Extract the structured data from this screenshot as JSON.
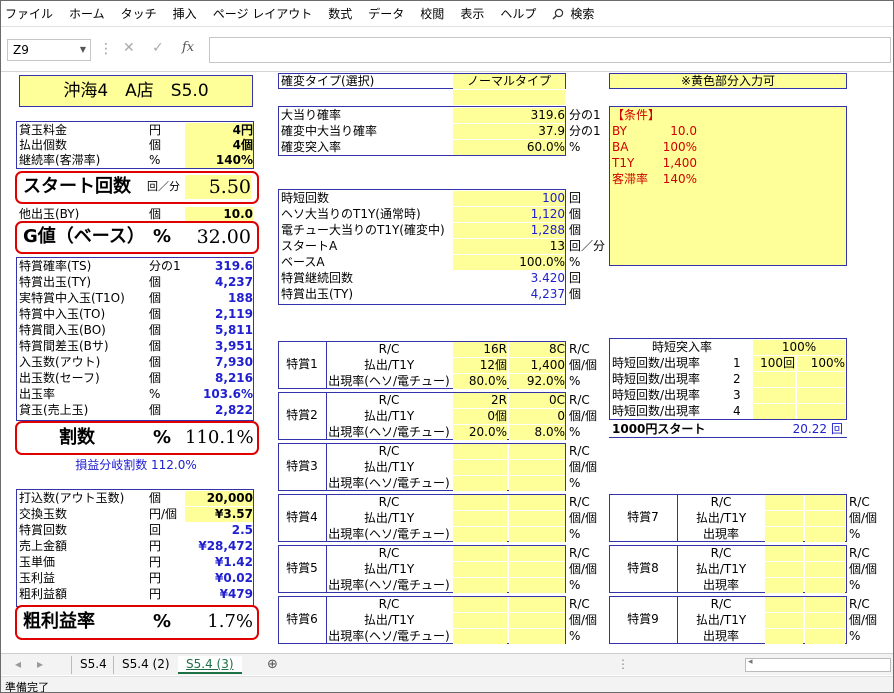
{
  "ribbon": {
    "tabs": [
      "ファイル",
      "ホーム",
      "タッチ",
      "挿入",
      "ページ レイアウト",
      "数式",
      "データ",
      "校閲",
      "表示",
      "ヘルプ"
    ],
    "search_label": "検索"
  },
  "formula_bar": {
    "name_box": "Z9",
    "formula": ""
  },
  "left": {
    "title": "沖海4　A店　S5.0",
    "rows1": [
      {
        "label": "貸玉料金",
        "unit": "円",
        "value": "4円"
      },
      {
        "label": "払出個数",
        "unit": "個",
        "value": "4個"
      },
      {
        "label": "継続率(客滞率)",
        "unit": "%",
        "value": "140%"
      }
    ],
    "start": {
      "label": "スタート回数",
      "unit": "回／分",
      "value": "5.50"
    },
    "by": {
      "label": "他出玉(BY)",
      "unit": "個",
      "value": "10.0"
    },
    "g": {
      "label": "G値（ベース）",
      "unit": "%",
      "value": "32.00"
    },
    "rows2": [
      {
        "label": "特賞確率(TS)",
        "unit": "分の1",
        "value": "319.6"
      },
      {
        "label": "特賞出玉(TY)",
        "unit": "個",
        "value": "4,237"
      },
      {
        "label": "実特賞中入玉(T1O)",
        "unit": "個",
        "value": "188"
      },
      {
        "label": "特賞中入玉(TO)",
        "unit": "個",
        "value": "2,119"
      },
      {
        "label": "特賞間入玉(BO)",
        "unit": "個",
        "value": "5,811"
      },
      {
        "label": "特賞間差玉(Bサ)",
        "unit": "個",
        "value": "3,951"
      },
      {
        "label": "入玉数(アウト)",
        "unit": "個",
        "value": "7,930"
      },
      {
        "label": "出玉数(セーフ)",
        "unit": "個",
        "value": "8,216"
      },
      {
        "label": "出玉率",
        "unit": "%",
        "value": "103.6%"
      },
      {
        "label": "貸玉(売上玉)",
        "unit": "個",
        "value": "2,822"
      }
    ],
    "warisu": {
      "label": "割数",
      "unit": "%",
      "value": "110.1%"
    },
    "breakeven": "損益分岐割数 112.0%",
    "rows3": [
      {
        "label": "打込数(アウト玉数)",
        "unit": "個",
        "value": "20,000"
      },
      {
        "label": "交換玉数",
        "unit": "円/個",
        "value": "¥3.57"
      },
      {
        "label": "特賞回数",
        "unit": "回",
        "value": "2.5"
      },
      {
        "label": "売上金額",
        "unit": "円",
        "value": "¥28,472"
      },
      {
        "label": "玉単価",
        "unit": "円",
        "value": "¥1.42"
      },
      {
        "label": "玉利益",
        "unit": "円",
        "value": "¥0.02"
      },
      {
        "label": "粗利益額",
        "unit": "円",
        "value": "¥479"
      }
    ],
    "arari": {
      "label": "粗利益率",
      "unit": "%",
      "value": "1.7%"
    }
  },
  "middle": {
    "type_label": "確変タイプ(選択)",
    "type_value": "ノーマルタイプ",
    "probs": [
      {
        "label": "大当り確率",
        "value": "319.6",
        "unit": "分の1"
      },
      {
        "label": "確変中大当り確率",
        "value": "37.9",
        "unit": "分の1"
      },
      {
        "label": "確変突入率",
        "value": "60.0%",
        "unit": "%"
      }
    ],
    "jitan": [
      {
        "label": "時短回数",
        "value": "100",
        "unit": "回"
      },
      {
        "label": "ヘソ大当りのT1Y(通常時)",
        "value": "1,120",
        "unit": "個"
      },
      {
        "label": "電チュー大当りのT1Y(確変中)",
        "value": "1,288",
        "unit": "個"
      },
      {
        "label": "スタートA",
        "value": "13",
        "unit": "回／分"
      },
      {
        "label": "ベースA",
        "value": "100.0%",
        "unit": "%"
      },
      {
        "label": "特賞継続回数",
        "value": "3.420",
        "unit": "回"
      },
      {
        "label": "特賞出玉(TY)",
        "value": "4,237",
        "unit": "個"
      }
    ]
  },
  "prize": {
    "sublabels": [
      "R/C",
      "払出/T1Y",
      "出現率(ヘソ/電チュー)"
    ],
    "units": [
      "R/C",
      "個/個",
      "%"
    ],
    "groups": [
      {
        "name": "特賞1",
        "a": [
          "16R",
          "12個",
          "80.0%"
        ],
        "b": [
          "8C",
          "1,400",
          "92.0%"
        ]
      },
      {
        "name": "特賞2",
        "a": [
          "2R",
          "0個",
          "20.0%"
        ],
        "b": [
          "0C",
          "0",
          "8.0%"
        ]
      },
      {
        "name": "特賞3",
        "a": [
          "",
          "",
          ""
        ],
        "b": [
          "",
          "",
          ""
        ]
      },
      {
        "name": "特賞4",
        "a": [
          "",
          "",
          ""
        ],
        "b": [
          "",
          "",
          ""
        ]
      },
      {
        "name": "特賞5",
        "a": [
          "",
          "",
          ""
        ],
        "b": [
          "",
          "",
          ""
        ]
      },
      {
        "name": "特賞6",
        "a": [
          "",
          "",
          ""
        ],
        "b": [
          "",
          "",
          ""
        ]
      }
    ]
  },
  "right": {
    "note": "※黄色部分入力可",
    "cond_title": "【条件】",
    "conditions": [
      {
        "k": "BY",
        "v": "10.0"
      },
      {
        "k": "BA",
        "v": "100%"
      },
      {
        "k": "T1Y",
        "v": "1,400"
      },
      {
        "k": "客滞率",
        "v": "140%"
      }
    ],
    "jitan_rate_label": "時短突入率",
    "jitan_rate_value": "100%",
    "jitan_rows": [
      {
        "label": "時短回数/出現率",
        "n": "1",
        "a": "100回",
        "b": "100%"
      },
      {
        "label": "時短回数/出現率",
        "n": "2",
        "a": "",
        "b": ""
      },
      {
        "label": "時短回数/出現率",
        "n": "3",
        "a": "",
        "b": ""
      },
      {
        "label": "時短回数/出現率",
        "n": "4",
        "a": "",
        "b": ""
      }
    ],
    "start1000_label": "1000円スタート",
    "start1000_value": "20.22",
    "start1000_unit": "回",
    "sublabels": [
      "R/C",
      "払出/T1Y",
      "出現率"
    ],
    "units": [
      "R/C",
      "個/個",
      "%"
    ],
    "groups": [
      {
        "name": "特賞7"
      },
      {
        "name": "特賞8"
      },
      {
        "name": "特賞9"
      }
    ]
  },
  "sheet_tabs": [
    "S5.4",
    "S5.4 (2)",
    "S5.4 (3)"
  ],
  "status": "準備完了"
}
